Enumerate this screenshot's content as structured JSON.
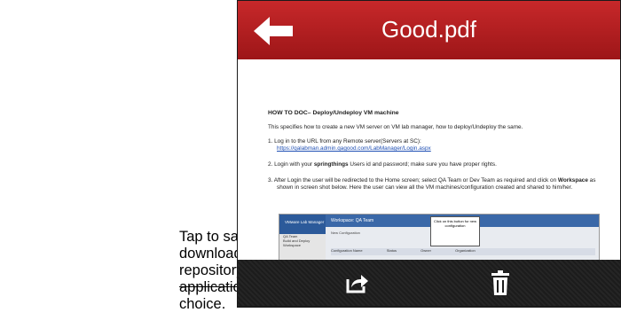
{
  "callout": {
    "text": "Tap to save the downloaded file in the file repository or open in an application of your choice."
  },
  "header": {
    "title": "Good.pdf",
    "back_icon": "back-arrow-icon",
    "color": "#b81e20"
  },
  "document": {
    "heading": "HOW TO DOC– Deploy/Undeploy VM machine",
    "intro": "This specifies how to create a new VM server on VM lab manager, how to deploy/Undeploy the same.",
    "step1_text": "1.  Log in to the URL from any Remote server(Servers at SC):",
    "step1_link": "https://qalabman.admin.qagood.com/LabManager/Login.aspx",
    "step2_a": "2.  Login with your ",
    "step2_b": "springthings",
    "step2_c": " Users id and password; make sure you have proper rights.",
    "step3_a": "3.  After Login the user will be redirected to the Home screen; select QA Team or Dev Team as required and click on ",
    "step3_b": "Workspace",
    "step3_c": " as shown in screen shot below.  Here the user can view all the VM machines/configuration created and shared to him/her.",
    "screenshot": {
      "logo": "VMware Lab Manager",
      "workspace": "Workspace: QA Team",
      "new_config": "New Configuration",
      "note": "Click on this button for new configuration",
      "side1": "QA Team",
      "side2": "Build and Deploy",
      "side3": "Workspace",
      "col_config": "Configuration Name",
      "col_status": "Status",
      "col_owner": "Owner",
      "col_org": "Organization"
    }
  },
  "toolbar": {
    "share_icon": "share-icon",
    "trash_icon": "trash-icon"
  }
}
